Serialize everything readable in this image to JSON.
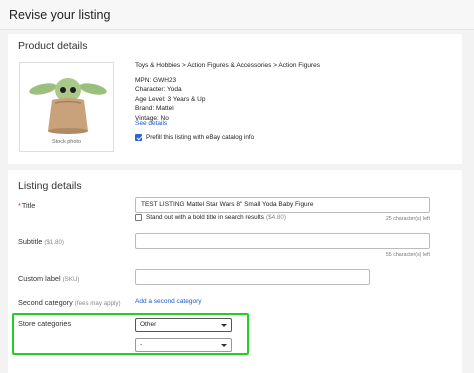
{
  "page": {
    "title": "Revise your listing"
  },
  "product": {
    "section_title": "Product details",
    "stock_caption": "Stock photo",
    "category_path": "Toys & Hobbies > Action Figures & Accessories > Action Figures",
    "specifics": [
      "MPN: GWH23",
      "Character: Yoda",
      "Age Level: 3 Years & Up",
      "Brand: Mattel",
      "Vintage: No"
    ],
    "see_details": "See details",
    "prefill_label": "Prefill this listing with eBay catalog info",
    "prefill_checked": true
  },
  "listing": {
    "section_title": "Listing details",
    "title_field": {
      "required_mark": "*",
      "label": "Title",
      "value": "TEST LISTING Mattel Star Wars 8\" Small Yoda Baby Figure",
      "counter": "25 character(s) left"
    },
    "bold_title": {
      "label": "Stand out with a bold title in search results",
      "fee": "($4.80)",
      "checked": false
    },
    "subtitle_field": {
      "label": "Subtitle",
      "fee": "($1.80)",
      "value": "",
      "counter": "55 character(s) left"
    },
    "custom_label_field": {
      "label": "Custom label",
      "note": "(SKU)",
      "value": ""
    },
    "second_category": {
      "label": "Second category",
      "fee": "(fees may apply)",
      "link": "Add a second category"
    },
    "store_categories": {
      "label": "Store categories",
      "primary_value": "Other",
      "secondary_value": "-",
      "highlight_color": "#22d11f"
    }
  }
}
